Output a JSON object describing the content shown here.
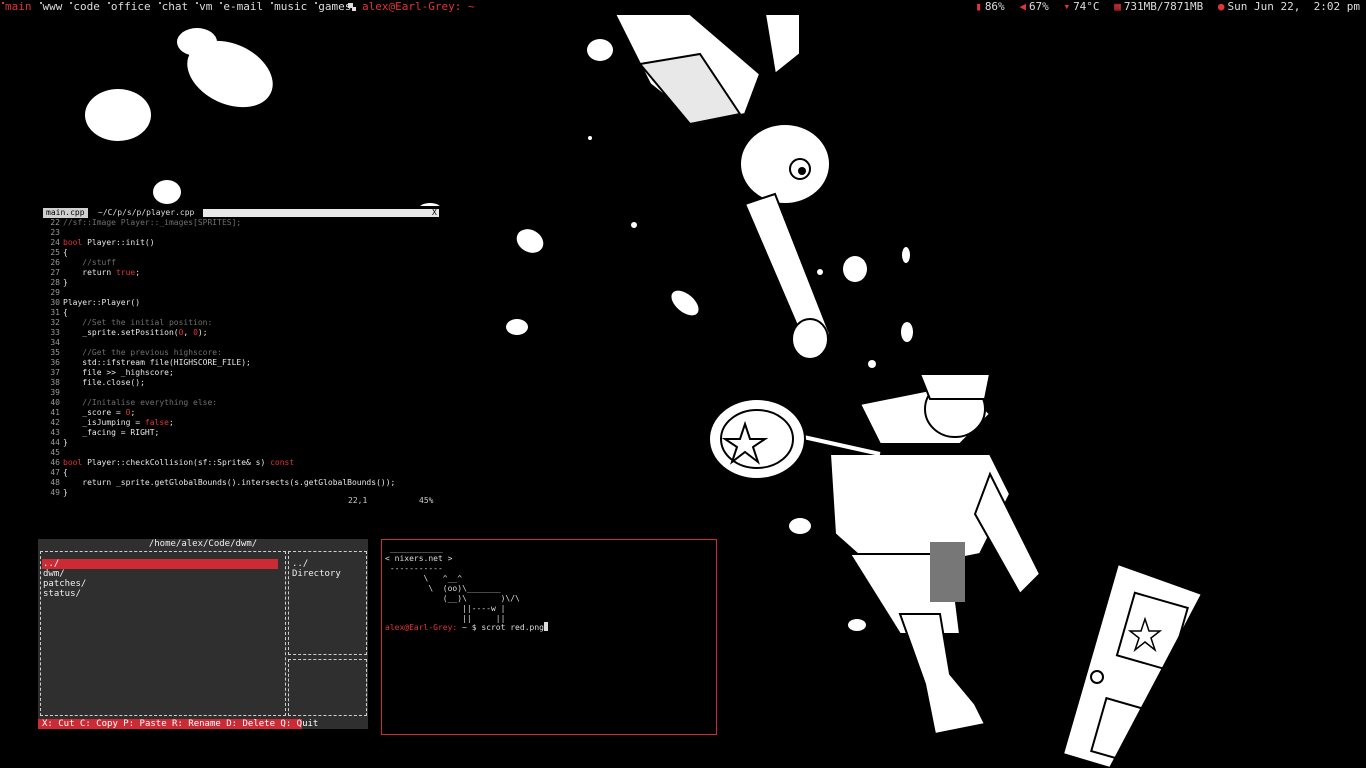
{
  "topbar": {
    "tags": [
      "main",
      "www",
      "code",
      "office",
      "chat",
      "vm",
      "e-mail",
      "music",
      "games"
    ],
    "active_tag": "main",
    "window_title": "alex@Earl-Grey: ~",
    "status": {
      "battery": "86%",
      "volume": "67%",
      "temp": "74°C",
      "memory": "731MB/7871MB",
      "datetime": "Sun Jun 22,  2:02 pm"
    }
  },
  "vim": {
    "tab_active": "main.cpp",
    "tab_path": "~/C/p/s/p/player.cpp",
    "tab_close": "X",
    "lines": [
      {
        "n": "22",
        "t": "//sf::Image Player::_images[SPRITES];",
        "k": "cmt"
      },
      {
        "n": "23",
        "t": "",
        "k": "txt"
      },
      {
        "n": "24",
        "t": "bool Player::init()",
        "k": "kwstart"
      },
      {
        "n": "25",
        "t": "{",
        "k": "txt"
      },
      {
        "n": "26",
        "t": "    //stuff",
        "k": "cmt"
      },
      {
        "n": "27",
        "t": "    return true;",
        "k": "ret"
      },
      {
        "n": "28",
        "t": "}",
        "k": "txt"
      },
      {
        "n": "29",
        "t": "",
        "k": "txt"
      },
      {
        "n": "30",
        "t": "Player::Player()",
        "k": "txt"
      },
      {
        "n": "31",
        "t": "{",
        "k": "txt"
      },
      {
        "n": "32",
        "t": "    //Set the initial position:",
        "k": "cmt"
      },
      {
        "n": "33",
        "t": "    _sprite.setPosition(0, 0);",
        "k": "txt"
      },
      {
        "n": "34",
        "t": "",
        "k": "txt"
      },
      {
        "n": "35",
        "t": "    //Get the previous highscore:",
        "k": "cmt"
      },
      {
        "n": "36",
        "t": "    std::ifstream file(HIGHSCORE_FILE);",
        "k": "txt"
      },
      {
        "n": "37",
        "t": "    file >> _highscore;",
        "k": "txt"
      },
      {
        "n": "38",
        "t": "    file.close();",
        "k": "txt"
      },
      {
        "n": "39",
        "t": "",
        "k": "txt"
      },
      {
        "n": "40",
        "t": "    //Initalise everything else:",
        "k": "cmt"
      },
      {
        "n": "41",
        "t": "    _score = 0;",
        "k": "txt"
      },
      {
        "n": "42",
        "t": "    _isJumping = false;",
        "k": "txt"
      },
      {
        "n": "43",
        "t": "    _facing = RIGHT;",
        "k": "txt"
      },
      {
        "n": "44",
        "t": "}",
        "k": "txt"
      },
      {
        "n": "45",
        "t": "",
        "k": "txt"
      },
      {
        "n": "46",
        "t": "bool Player::checkCollision(sf::Sprite& s) const",
        "k": "kwstart"
      },
      {
        "n": "47",
        "t": "{",
        "k": "txt"
      },
      {
        "n": "48",
        "t": "    return _sprite.getGlobalBounds().intersects(s.getGlobalBounds());",
        "k": "txt"
      },
      {
        "n": "49",
        "t": "}",
        "k": "txt"
      }
    ],
    "ruler": "22,1",
    "percent": "45%"
  },
  "filemanager": {
    "path": "/home/alex/Code/dwm/",
    "entries": [
      "../",
      "dwm/",
      "patches/",
      "status/"
    ],
    "selected_index": 0,
    "preview": [
      "../",
      "Directory"
    ],
    "help": "X: Cut C: Copy P: Paste R: Rename D: Delete Q: Quit"
  },
  "terminal": {
    "cowsay": " ___________\n< nixers.net >\n -----------\n        \\   ^__^\n         \\  (oo)\\_______\n            (__)\\       )\\/\\\n                ||----w |\n                ||     ||",
    "prompt_user": "alex@Earl-Grey:",
    "prompt_rest": " ~ $ ",
    "command": "scrot red.png"
  },
  "colors": {
    "accent": "#e0333a",
    "background": "#000000",
    "panel": "#2f2f2f"
  }
}
